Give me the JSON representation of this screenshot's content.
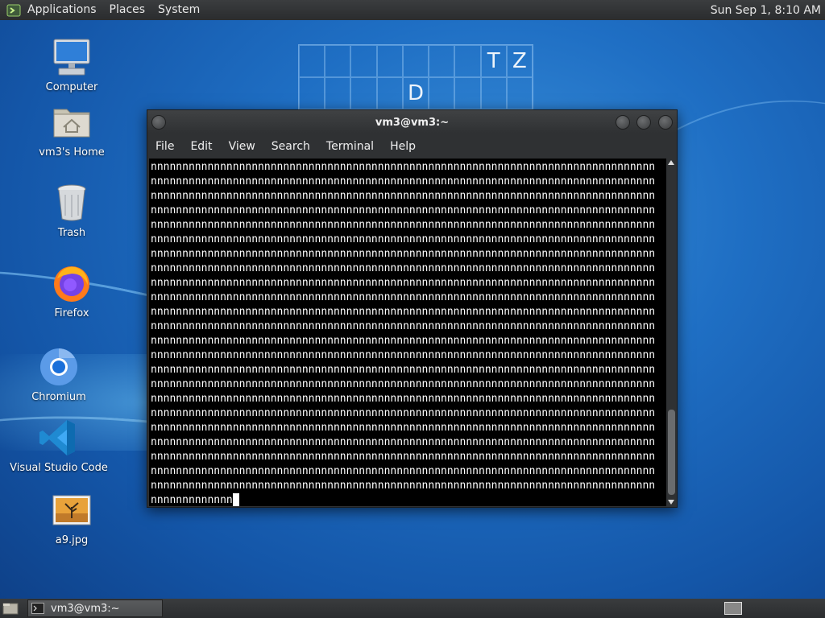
{
  "top_panel": {
    "menu": [
      "Applications",
      "Places",
      "System"
    ],
    "clock": "Sun Sep  1,  8:10 AM"
  },
  "wallpaper_grid": {
    "row1": [
      "",
      "",
      "",
      "",
      "",
      "",
      "",
      "T",
      "Z"
    ],
    "row2": [
      "",
      "",
      "",
      "",
      "D",
      "",
      "",
      "",
      ""
    ]
  },
  "desktop_icons": [
    {
      "label": "Computer",
      "icon": "computer-icon"
    },
    {
      "label": "vm3's Home",
      "icon": "home-folder-icon"
    },
    {
      "label": "Trash",
      "icon": "trash-icon"
    },
    {
      "label": "Firefox",
      "icon": "firefox-icon"
    },
    {
      "label": "Chromium",
      "icon": "chromium-icon"
    },
    {
      "label": "Visual Studio Code",
      "icon": "vscode-icon"
    },
    {
      "label": "a9.jpg",
      "icon": "image-file-icon"
    }
  ],
  "terminal": {
    "title": "vm3@vm3:~",
    "menu": [
      "File",
      "Edit",
      "View",
      "Search",
      "Terminal",
      "Help"
    ],
    "full_line": "nnnnnnnnnnnnnnnnnnnnnnnnnnnnnnnnnnnnnnnnnnnnnnnnnnnnnnnnnnnnnnnnnnnnnnnnnnnnnnnn",
    "full_line_count": 23,
    "last_line": "nnnnnnnnnnnnn"
  },
  "taskbar": {
    "window_button": "vm3@vm3:~"
  },
  "colors": {
    "panel": "#2f3133",
    "terminal_bg": "#000000",
    "terminal_fg": "#ffffff",
    "wallpaper": "#1f6fc4"
  }
}
